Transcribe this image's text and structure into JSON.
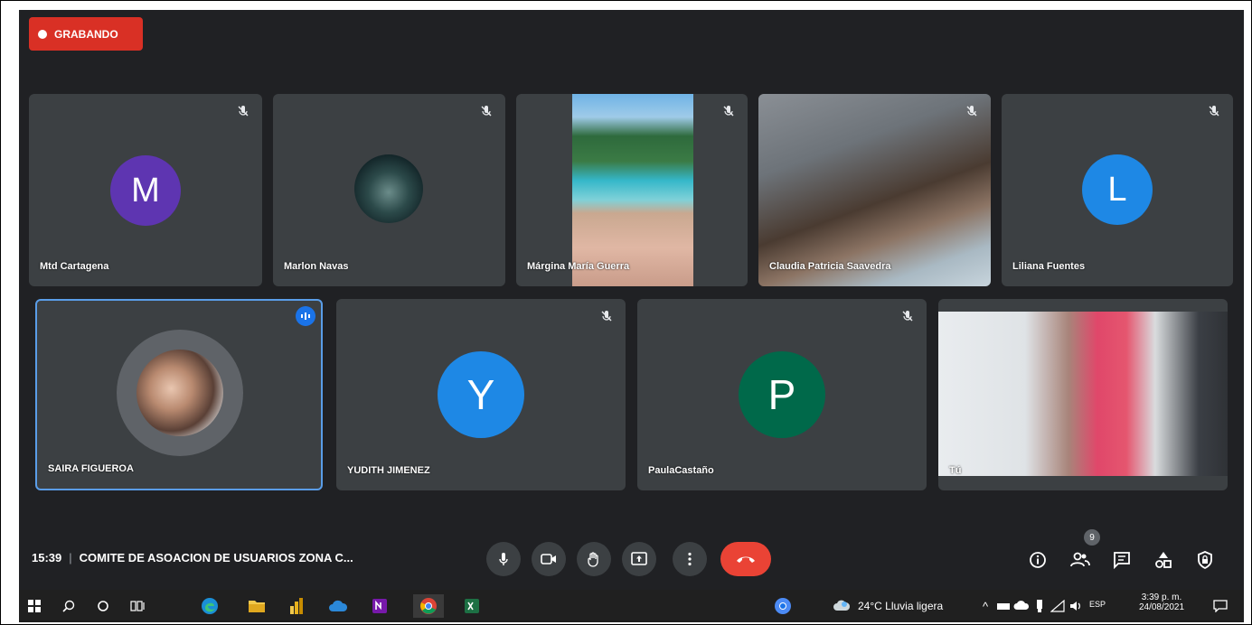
{
  "recording": {
    "label": "GRABANDO"
  },
  "participants_row1": [
    {
      "name": "Mtd Cartagena",
      "initial": "M",
      "color": "#5e35b1"
    },
    {
      "name": "Marlon Navas"
    },
    {
      "name": "Márgina María Guerra"
    },
    {
      "name": "Claudia Patricia Saavedra"
    },
    {
      "name": "Liliana Fuentes",
      "initial": "L",
      "color": "#1e88e5"
    }
  ],
  "participants_row2": [
    {
      "name": "SAIRA FIGUEROA"
    },
    {
      "name": "YUDITH JIMENEZ",
      "initial": "Y",
      "color": "#1e88e5"
    },
    {
      "name": "PaulaCastaño",
      "initial": "P",
      "color": "#00694a"
    },
    {
      "name": "Tú"
    }
  ],
  "meeting": {
    "time": "15:39",
    "separator": "|",
    "title": "COMITE DE ASOACION DE USUARIOS ZONA C..."
  },
  "people_count": "9",
  "taskbar": {
    "weather": "24°C  Lluvia ligera",
    "lang": "ESP",
    "clock_time": "3:39 p. m.",
    "clock_date": "24/08/2021"
  },
  "colors": {
    "accent": "#8ab4f8",
    "end_call": "#ea4335",
    "recording": "#d93025"
  }
}
